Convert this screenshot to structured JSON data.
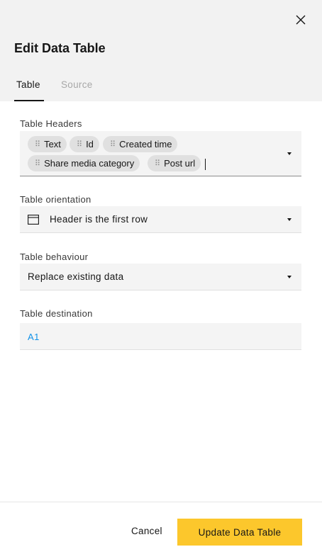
{
  "dialog": {
    "title": "Edit Data Table",
    "tabs": [
      {
        "label": "Table",
        "active": true
      },
      {
        "label": "Source",
        "active": false
      }
    ]
  },
  "table_headers": {
    "label": "Table Headers",
    "chips": [
      "Text",
      "Id",
      "Created time",
      "Share media category",
      "Post url"
    ]
  },
  "orientation": {
    "label": "Table orientation",
    "value": "Header is the first row",
    "icon": "table-layout-icon"
  },
  "behaviour": {
    "label": "Table behaviour",
    "value": "Replace existing data"
  },
  "destination": {
    "label": "Table destination",
    "value": "A1"
  },
  "footer": {
    "cancel_label": "Cancel",
    "submit_label": "Update Data Table"
  },
  "colors": {
    "primary": "#fcc72c",
    "link": "#1192e8",
    "header_bg": "#f2f2f2"
  }
}
